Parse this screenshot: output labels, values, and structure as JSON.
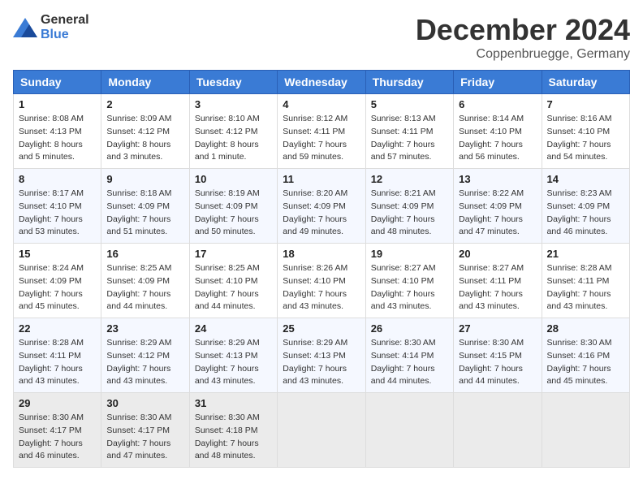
{
  "logo": {
    "general": "General",
    "blue": "Blue"
  },
  "title": {
    "month": "December 2024",
    "location": "Coppenbruegge, Germany"
  },
  "weekdays": [
    "Sunday",
    "Monday",
    "Tuesday",
    "Wednesday",
    "Thursday",
    "Friday",
    "Saturday"
  ],
  "weeks": [
    [
      {
        "day": "1",
        "sunrise": "Sunrise: 8:08 AM",
        "sunset": "Sunset: 4:13 PM",
        "daylight": "Daylight: 8 hours and 5 minutes."
      },
      {
        "day": "2",
        "sunrise": "Sunrise: 8:09 AM",
        "sunset": "Sunset: 4:12 PM",
        "daylight": "Daylight: 8 hours and 3 minutes."
      },
      {
        "day": "3",
        "sunrise": "Sunrise: 8:10 AM",
        "sunset": "Sunset: 4:12 PM",
        "daylight": "Daylight: 8 hours and 1 minute."
      },
      {
        "day": "4",
        "sunrise": "Sunrise: 8:12 AM",
        "sunset": "Sunset: 4:11 PM",
        "daylight": "Daylight: 7 hours and 59 minutes."
      },
      {
        "day": "5",
        "sunrise": "Sunrise: 8:13 AM",
        "sunset": "Sunset: 4:11 PM",
        "daylight": "Daylight: 7 hours and 57 minutes."
      },
      {
        "day": "6",
        "sunrise": "Sunrise: 8:14 AM",
        "sunset": "Sunset: 4:10 PM",
        "daylight": "Daylight: 7 hours and 56 minutes."
      },
      {
        "day": "7",
        "sunrise": "Sunrise: 8:16 AM",
        "sunset": "Sunset: 4:10 PM",
        "daylight": "Daylight: 7 hours and 54 minutes."
      }
    ],
    [
      {
        "day": "8",
        "sunrise": "Sunrise: 8:17 AM",
        "sunset": "Sunset: 4:10 PM",
        "daylight": "Daylight: 7 hours and 53 minutes."
      },
      {
        "day": "9",
        "sunrise": "Sunrise: 8:18 AM",
        "sunset": "Sunset: 4:09 PM",
        "daylight": "Daylight: 7 hours and 51 minutes."
      },
      {
        "day": "10",
        "sunrise": "Sunrise: 8:19 AM",
        "sunset": "Sunset: 4:09 PM",
        "daylight": "Daylight: 7 hours and 50 minutes."
      },
      {
        "day": "11",
        "sunrise": "Sunrise: 8:20 AM",
        "sunset": "Sunset: 4:09 PM",
        "daylight": "Daylight: 7 hours and 49 minutes."
      },
      {
        "day": "12",
        "sunrise": "Sunrise: 8:21 AM",
        "sunset": "Sunset: 4:09 PM",
        "daylight": "Daylight: 7 hours and 48 minutes."
      },
      {
        "day": "13",
        "sunrise": "Sunrise: 8:22 AM",
        "sunset": "Sunset: 4:09 PM",
        "daylight": "Daylight: 7 hours and 47 minutes."
      },
      {
        "day": "14",
        "sunrise": "Sunrise: 8:23 AM",
        "sunset": "Sunset: 4:09 PM",
        "daylight": "Daylight: 7 hours and 46 minutes."
      }
    ],
    [
      {
        "day": "15",
        "sunrise": "Sunrise: 8:24 AM",
        "sunset": "Sunset: 4:09 PM",
        "daylight": "Daylight: 7 hours and 45 minutes."
      },
      {
        "day": "16",
        "sunrise": "Sunrise: 8:25 AM",
        "sunset": "Sunset: 4:09 PM",
        "daylight": "Daylight: 7 hours and 44 minutes."
      },
      {
        "day": "17",
        "sunrise": "Sunrise: 8:25 AM",
        "sunset": "Sunset: 4:10 PM",
        "daylight": "Daylight: 7 hours and 44 minutes."
      },
      {
        "day": "18",
        "sunrise": "Sunrise: 8:26 AM",
        "sunset": "Sunset: 4:10 PM",
        "daylight": "Daylight: 7 hours and 43 minutes."
      },
      {
        "day": "19",
        "sunrise": "Sunrise: 8:27 AM",
        "sunset": "Sunset: 4:10 PM",
        "daylight": "Daylight: 7 hours and 43 minutes."
      },
      {
        "day": "20",
        "sunrise": "Sunrise: 8:27 AM",
        "sunset": "Sunset: 4:11 PM",
        "daylight": "Daylight: 7 hours and 43 minutes."
      },
      {
        "day": "21",
        "sunrise": "Sunrise: 8:28 AM",
        "sunset": "Sunset: 4:11 PM",
        "daylight": "Daylight: 7 hours and 43 minutes."
      }
    ],
    [
      {
        "day": "22",
        "sunrise": "Sunrise: 8:28 AM",
        "sunset": "Sunset: 4:11 PM",
        "daylight": "Daylight: 7 hours and 43 minutes."
      },
      {
        "day": "23",
        "sunrise": "Sunrise: 8:29 AM",
        "sunset": "Sunset: 4:12 PM",
        "daylight": "Daylight: 7 hours and 43 minutes."
      },
      {
        "day": "24",
        "sunrise": "Sunrise: 8:29 AM",
        "sunset": "Sunset: 4:13 PM",
        "daylight": "Daylight: 7 hours and 43 minutes."
      },
      {
        "day": "25",
        "sunrise": "Sunrise: 8:29 AM",
        "sunset": "Sunset: 4:13 PM",
        "daylight": "Daylight: 7 hours and 43 minutes."
      },
      {
        "day": "26",
        "sunrise": "Sunrise: 8:30 AM",
        "sunset": "Sunset: 4:14 PM",
        "daylight": "Daylight: 7 hours and 44 minutes."
      },
      {
        "day": "27",
        "sunrise": "Sunrise: 8:30 AM",
        "sunset": "Sunset: 4:15 PM",
        "daylight": "Daylight: 7 hours and 44 minutes."
      },
      {
        "day": "28",
        "sunrise": "Sunrise: 8:30 AM",
        "sunset": "Sunset: 4:16 PM",
        "daylight": "Daylight: 7 hours and 45 minutes."
      }
    ],
    [
      {
        "day": "29",
        "sunrise": "Sunrise: 8:30 AM",
        "sunset": "Sunset: 4:17 PM",
        "daylight": "Daylight: 7 hours and 46 minutes."
      },
      {
        "day": "30",
        "sunrise": "Sunrise: 8:30 AM",
        "sunset": "Sunset: 4:17 PM",
        "daylight": "Daylight: 7 hours and 47 minutes."
      },
      {
        "day": "31",
        "sunrise": "Sunrise: 8:30 AM",
        "sunset": "Sunset: 4:18 PM",
        "daylight": "Daylight: 7 hours and 48 minutes."
      },
      null,
      null,
      null,
      null
    ]
  ]
}
